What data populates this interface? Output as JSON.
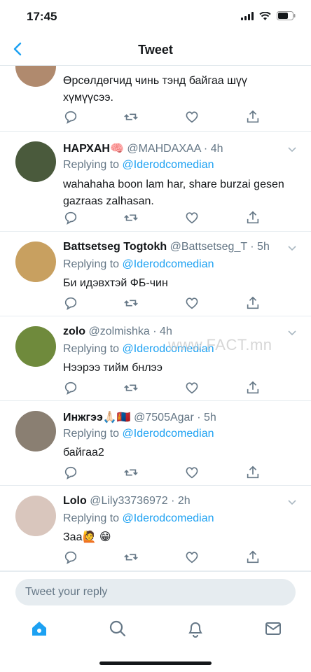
{
  "status_bar": {
    "time": "17:45"
  },
  "nav": {
    "title": "Tweet"
  },
  "tweets": [
    {
      "name": "",
      "handle": "",
      "replying_label": "",
      "replying_mention": "",
      "text": "Өрсөлдөгчид чинь тэнд байгаа шүү хүмүүсээ.",
      "avatar_color": "#b08a6e"
    },
    {
      "name": "НАРХАН🧠",
      "handle": "@MAHDAXAA · 4h",
      "replying_label": "Replying to ",
      "replying_mention": "@Iderodcomedian",
      "text": "wahahaha boon lam har, share burzai gesen gazraas zalhasan.",
      "avatar_color": "#4a5a3c"
    },
    {
      "name": "Battsetseg Togtokh",
      "handle": "@Battsetseg_T · 5h",
      "replying_label": "Replying to ",
      "replying_mention": "@Iderodcomedian",
      "text": "Би идэвхтэй ФБ-чин",
      "avatar_color": "#c8a060"
    },
    {
      "name": "zolo",
      "handle": "@zolmishka · 4h",
      "replying_label": "Replying to ",
      "replying_mention": "@Iderodcomedian",
      "text": "Нээрээ тийм бнлээ",
      "avatar_color": "#6f8a3c"
    },
    {
      "name": "Инжгээ🙏🏻🇲🇳",
      "handle": "@7505Agar · 5h",
      "replying_label": "Replying to ",
      "replying_mention": "@Iderodcomedian",
      "text": "байгаа2",
      "avatar_color": "#8a7f72"
    },
    {
      "name": "Lolo",
      "handle": "@Lily33736972 · 2h",
      "replying_label": "Replying to ",
      "replying_mention": "@Iderodcomedian",
      "text": "Заа🙋 😁",
      "avatar_color": "#d9c6bd"
    }
  ],
  "watermark": "www.FACT.mn",
  "reply_bar": {
    "placeholder": "Tweet your reply"
  },
  "colors": {
    "accent": "#1da1f2",
    "secondary_text": "#657786",
    "divider": "#e6ecf0"
  }
}
